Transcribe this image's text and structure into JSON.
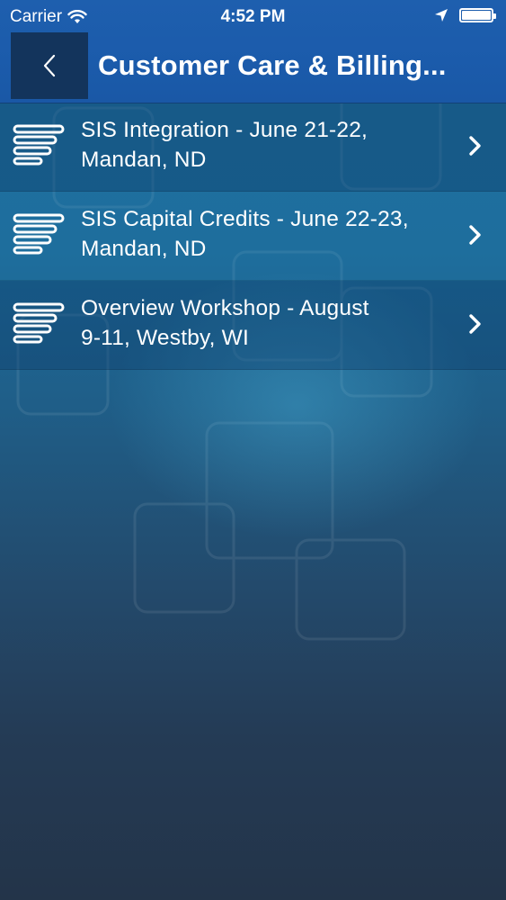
{
  "status_bar": {
    "carrier": "Carrier",
    "time": "4:52 PM",
    "battery_level": 1.0
  },
  "nav": {
    "back_icon": "chevron-left-icon",
    "title": "Customer Care & Billing..."
  },
  "list": {
    "items": [
      {
        "label_line1": "SIS Integration - June 21-22,",
        "label_line2": "Mandan, ND",
        "icon": "text-lines-icon"
      },
      {
        "label_line1": "SIS Capital Credits - June 22-23,",
        "label_line2": "Mandan, ND",
        "icon": "text-lines-icon"
      },
      {
        "label_line1": "Overview Workshop - August",
        "label_line2": "9-11, Westby, WI",
        "icon": "text-lines-icon"
      }
    ]
  },
  "colors": {
    "nav_bar": "#1c5cab",
    "back_button": "#13345c",
    "background_top": "#1f6f9e",
    "background_bottom": "#233449",
    "text": "#ffffff"
  }
}
